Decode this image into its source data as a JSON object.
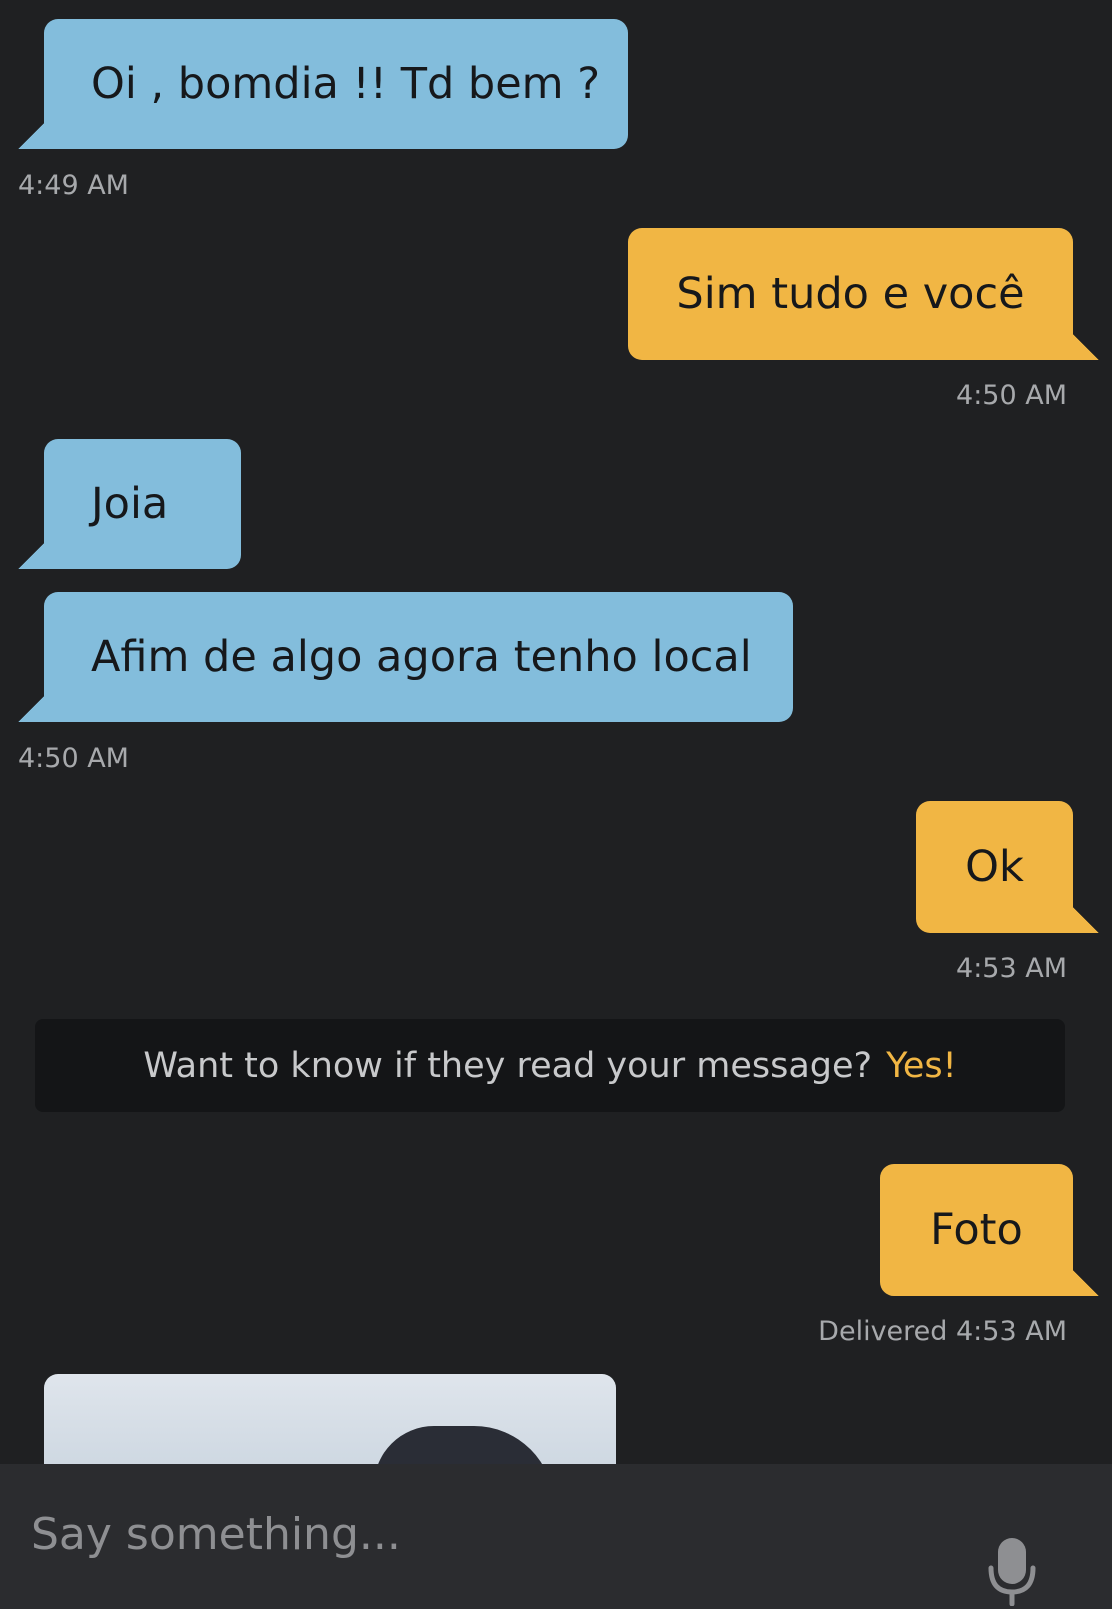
{
  "messages": [
    {
      "text": "Oi , bomdia !! Td bem ?",
      "direction": "in"
    },
    {
      "time": "4:49 AM"
    },
    {
      "text": "Sim tudo e você",
      "direction": "out"
    },
    {
      "time": "4:50 AM"
    },
    {
      "text": "Joia",
      "direction": "in"
    },
    {
      "text": "Afim de algo agora tenho local",
      "direction": "in"
    },
    {
      "time": "4:50 AM"
    },
    {
      "text": "Ok",
      "direction": "out"
    },
    {
      "time": "4:53 AM"
    },
    {
      "text": "Foto",
      "direction": "out"
    },
    {
      "time": "Delivered 4:53 AM"
    }
  ],
  "promo": {
    "text": "Want to know if they read your message?",
    "cta": "Yes!"
  },
  "composer": {
    "placeholder": "Say something..."
  },
  "icons": {
    "mic": "microphone-icon"
  },
  "colors": {
    "background": "#1f2022",
    "incoming_bubble": "#83bddc",
    "outgoing_bubble": "#f1b644",
    "accent": "#f1b644",
    "timestamp": "#a7a9ac"
  }
}
